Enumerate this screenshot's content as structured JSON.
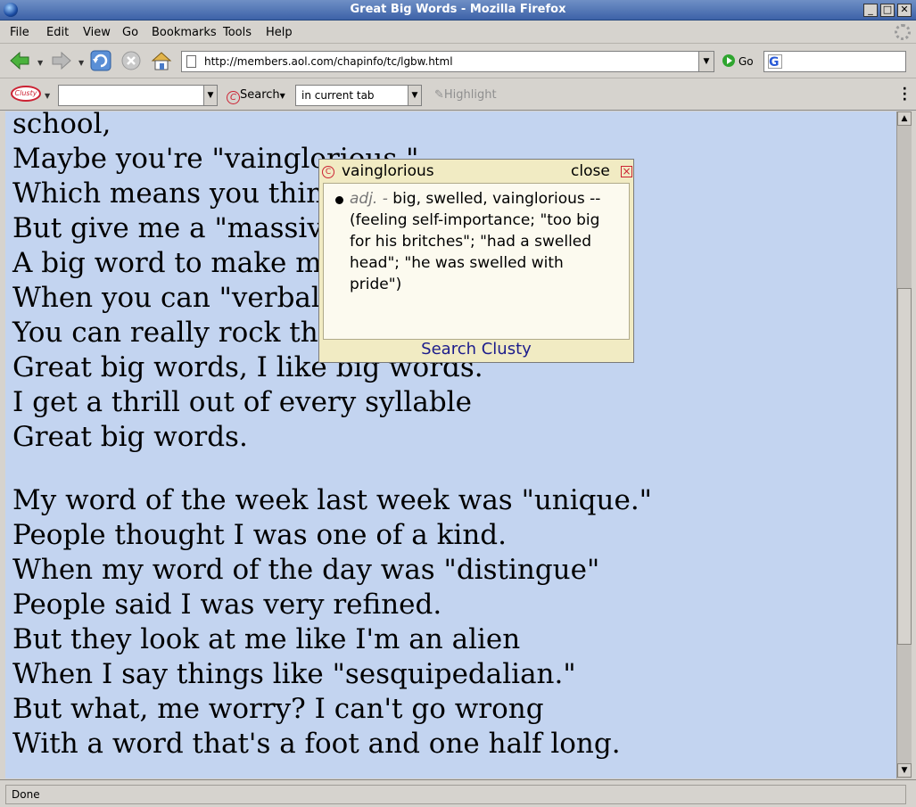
{
  "window": {
    "title": "Great Big Words - Mozilla Firefox",
    "minimize": "_",
    "maximize": "□",
    "close": "✕"
  },
  "menu": [
    {
      "label": "File"
    },
    {
      "label": "Edit"
    },
    {
      "label": "View"
    },
    {
      "label": "Go"
    },
    {
      "label": "Bookmarks"
    },
    {
      "label": "Tools"
    },
    {
      "label": "Help"
    }
  ],
  "navbar": {
    "url": "http://members.aol.com/chapinfo/tc/lgbw.html",
    "go_label": "Go",
    "icons": [
      "back-icon",
      "forward-icon",
      "reload-icon",
      "stop-icon",
      "home-icon"
    ]
  },
  "clusty": {
    "logo": "Clusty",
    "search_value": "",
    "search_label": "Search",
    "target": "in current tab",
    "highlight_label": "Highlight"
  },
  "poem": {
    "lines": [
      "school,",
      "Maybe you're \"vainglorious.\"",
      "Which means you think you're cool,",
      "But give me a \"massive\" word,",
      "A big word to make me mad,",
      "When you can \"verbalize,\"",
      "You can really rock the town.",
      "Great big words, I like big words.",
      "I get a thrill out of every syllable",
      "Great big words.",
      "My word of the week last week was \"unique.\"",
      "People thought I was one of a kind.",
      "When my word of the day was \"distingue\"",
      "People said I was very refined.",
      "But they look at me like I'm an alien",
      "When I say things like \"sesquipedalian.\"",
      "But what, me worry? I can't go wrong",
      "With a word that's a foot and one half long."
    ]
  },
  "popup": {
    "word": "vainglorious",
    "close_label": "close",
    "pos": "adj. -",
    "definition": "big, swelled, vainglorious -- (feeling self-importance; \"too big for his britches\"; \"had a swelled head\"; \"he was swelled with pride\")",
    "search_link": "Search Clusty"
  },
  "status": {
    "text": "Done"
  }
}
